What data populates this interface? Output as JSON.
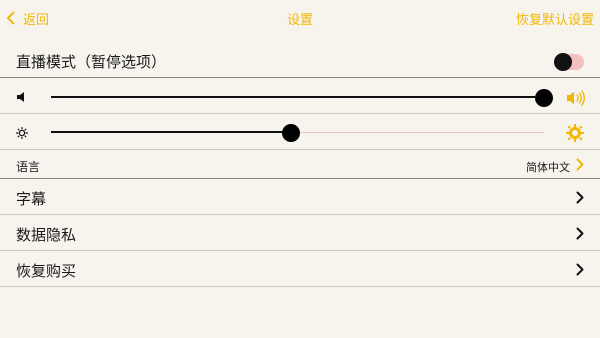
{
  "nav": {
    "back_label": "返回",
    "title": "设置",
    "reset_label": "恢复默认设置"
  },
  "live_mode": {
    "label": "直播模式（暂停选项）",
    "enabled": true
  },
  "volume": {
    "level": 1.0
  },
  "brightness": {
    "level": 0.487
  },
  "language": {
    "label": "语言",
    "value": "简体中文"
  },
  "menu": [
    {
      "label": "字幕"
    },
    {
      "label": "数据隐私"
    },
    {
      "label": "恢复购买"
    }
  ],
  "colors": {
    "accent": "#f2b705",
    "background": "#f7f4ee",
    "toggle_track": "#f2c0c0"
  },
  "icons": [
    "chevron-left-icon",
    "volume-low-icon",
    "volume-high-icon",
    "brightness-low-icon",
    "brightness-high-icon",
    "chevron-right-icon"
  ]
}
